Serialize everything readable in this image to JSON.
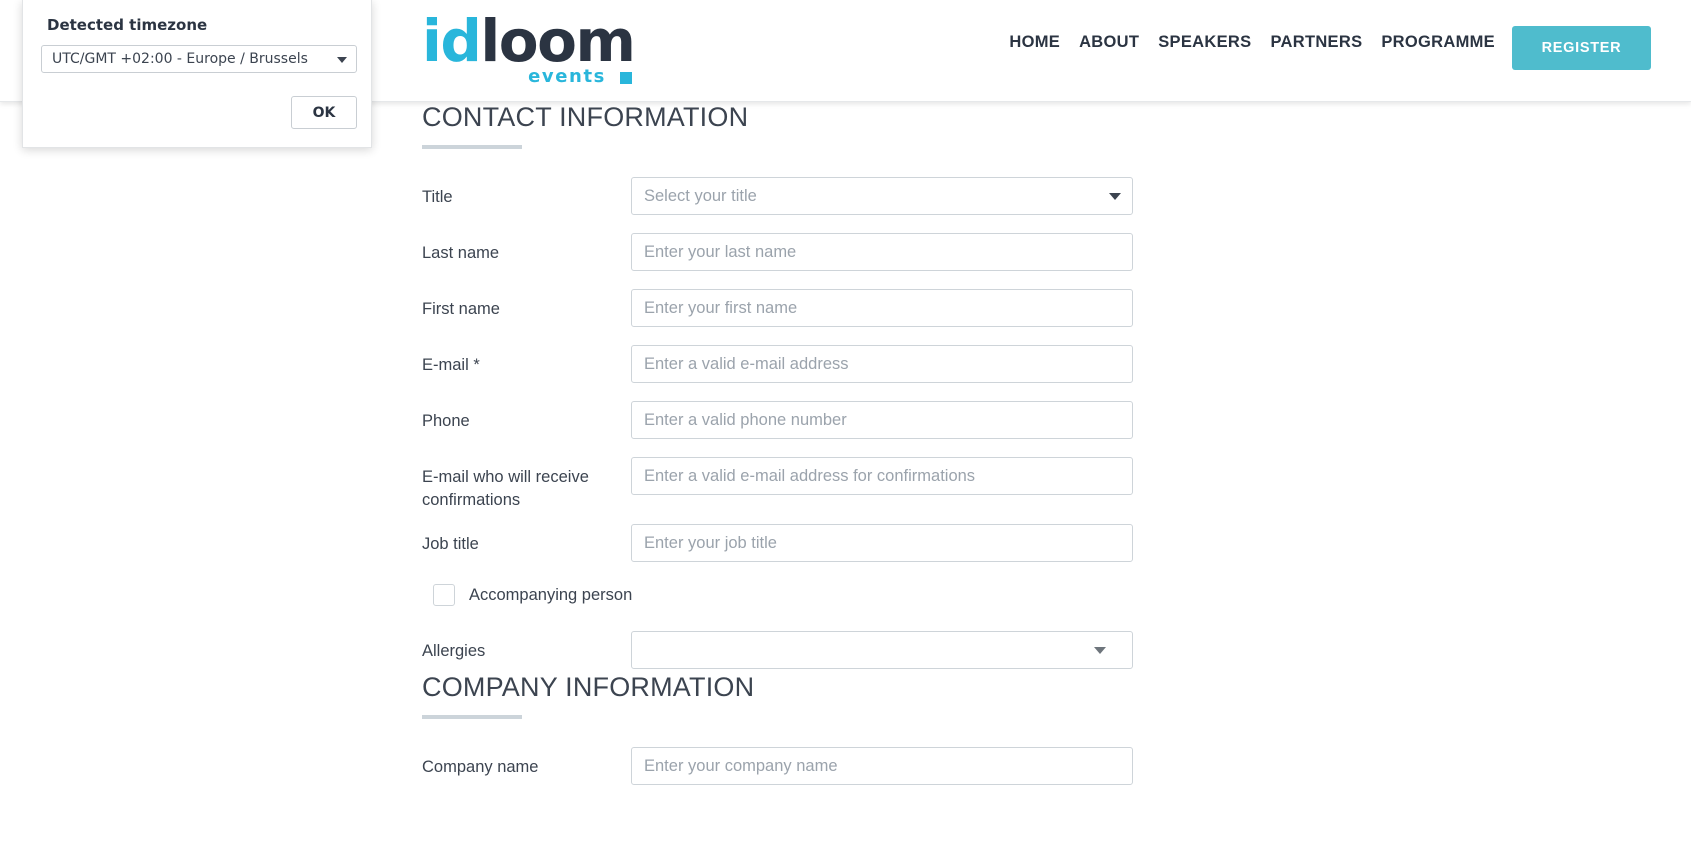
{
  "header": {
    "logo": {
      "part1": "id",
      "part2": "loom",
      "subtitle": "events"
    },
    "nav": [
      {
        "label": "HOME"
      },
      {
        "label": "ABOUT"
      },
      {
        "label": "SPEAKERS"
      },
      {
        "label": "PARTNERS"
      },
      {
        "label": "PROGRAMME"
      }
    ],
    "register_label": "REGISTER",
    "accent_color": "#4fbccd",
    "logo_cyan": "#29b6db",
    "logo_navy": "#2b3442"
  },
  "timezone_dialog": {
    "title": "Detected timezone",
    "selected_value": "UTC/GMT +02:00 - Europe / Brussels",
    "ok_label": "OK"
  },
  "contact_section": {
    "title": "CONTACT INFORMATION",
    "fields": [
      {
        "label": "Title",
        "placeholder": "Select your title",
        "type": "select"
      },
      {
        "label": "Last name",
        "placeholder": "Enter your last name",
        "type": "text"
      },
      {
        "label": "First name",
        "placeholder": "Enter your first name",
        "type": "text"
      },
      {
        "label": "E-mail *",
        "placeholder": "Enter a valid e-mail address",
        "type": "text"
      },
      {
        "label": "Phone",
        "placeholder": "Enter a valid phone number",
        "type": "text"
      },
      {
        "label": "E-mail who will receive confirmations",
        "placeholder": "Enter a valid e-mail address for confirmations",
        "type": "text"
      },
      {
        "label": "Job title",
        "placeholder": "Enter your job title",
        "type": "text"
      }
    ],
    "checkbox": {
      "label": "Accompanying person",
      "checked": false
    },
    "allergies": {
      "label": "Allergies",
      "value": "",
      "type": "select"
    }
  },
  "company_section": {
    "title": "COMPANY INFORMATION",
    "fields": [
      {
        "label": "Company name",
        "placeholder": "Enter your company name",
        "type": "text"
      }
    ]
  }
}
